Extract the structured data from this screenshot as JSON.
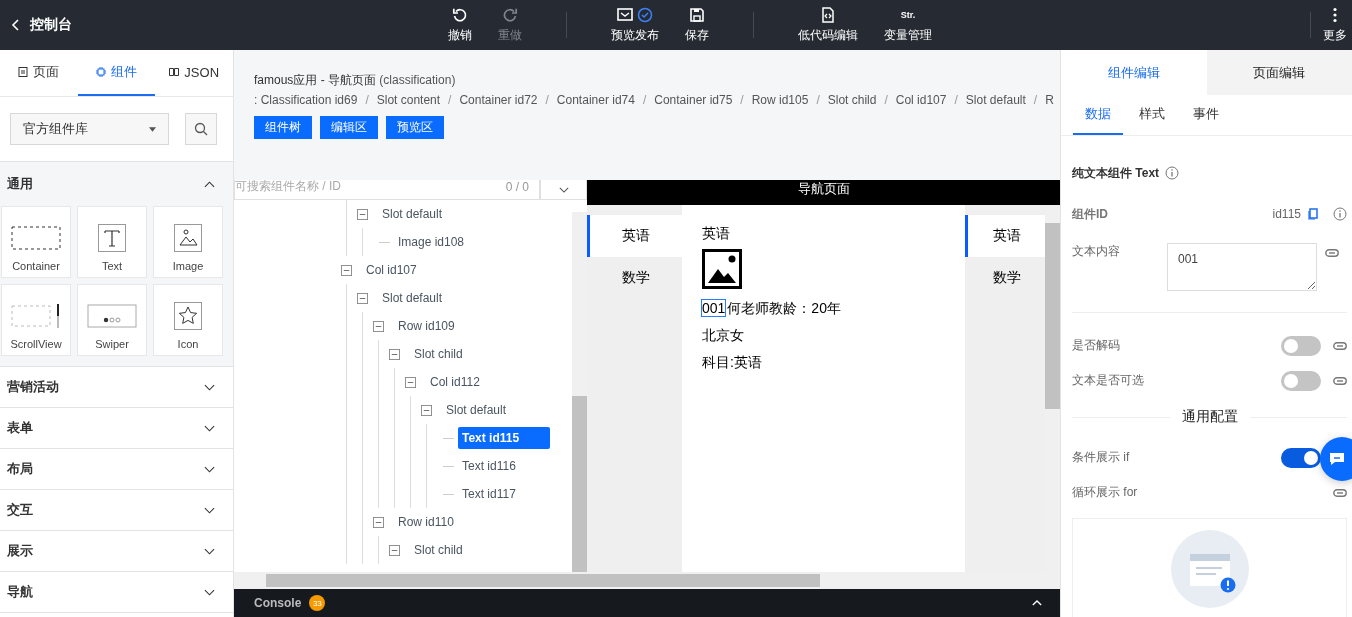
{
  "topbar": {
    "back_label": "控制台",
    "groups": [
      [
        {
          "kind": "undo",
          "label": "撤销",
          "disabled": false
        },
        {
          "kind": "redo",
          "label": "重做",
          "disabled": true
        }
      ],
      [
        {
          "kind": "preview",
          "label": "预览发布",
          "disabled": false
        },
        {
          "kind": "save",
          "label": "保存",
          "disabled": false
        }
      ],
      [
        {
          "kind": "code",
          "label": "低代码编辑",
          "disabled": false
        },
        {
          "kind": "variables",
          "label": "变量管理",
          "icon_text": "Str.",
          "disabled": false
        }
      ]
    ],
    "more": {
      "label": "更多"
    }
  },
  "left_panel": {
    "tabs": [
      {
        "kind": "page",
        "label": "页面",
        "selected": false
      },
      {
        "kind": "component",
        "label": "组件",
        "selected": true
      },
      {
        "kind": "json",
        "label": "JSON",
        "selected": false
      }
    ],
    "library_select": {
      "value": "官方组件库"
    },
    "categories": [
      {
        "title": "通用",
        "expanded": true,
        "components": [
          {
            "kind": "container",
            "label": "Container"
          },
          {
            "kind": "text",
            "label": "Text"
          },
          {
            "kind": "image",
            "label": "Image"
          },
          {
            "kind": "scrollview",
            "label": "ScrollView"
          },
          {
            "kind": "swiper",
            "label": "Swiper"
          },
          {
            "kind": "icon",
            "label": "Icon"
          }
        ]
      },
      {
        "title": "营销活动",
        "expanded": false
      },
      {
        "title": "表单",
        "expanded": false
      },
      {
        "title": "布局",
        "expanded": false
      },
      {
        "title": "交互",
        "expanded": false
      },
      {
        "title": "展示",
        "expanded": false
      },
      {
        "title": "导航",
        "expanded": false
      }
    ]
  },
  "editor_header": {
    "title": "famous应用 - 导航页面",
    "code": "(classification)",
    "breadcrumb": [
      ": Classification id69",
      "Slot content",
      "Container id72",
      "Container id74",
      "Container id75",
      "Row id105",
      "Slot child",
      "Col id107",
      "Slot default",
      "R"
    ],
    "separator": "/",
    "buttons": [
      "组件树",
      "编辑区",
      "预览区"
    ]
  },
  "component_tree": {
    "search": {
      "placeholder": "可搜索组件名称 / ID",
      "count": "0 / 0"
    },
    "nodes": [
      {
        "children": [
          {
            "label": "Slot default",
            "selected": false,
            "expanded": true,
            "children": [
              {
                "label": "Image id108",
                "selected": false
              }
            ]
          }
        ]
      },
      {
        "label": "Col id107",
        "selected": false,
        "expanded": true,
        "children": [
          {
            "label": "Slot default",
            "selected": false,
            "expanded": true,
            "children": [
              {
                "label": "Row id109",
                "selected": false,
                "expanded": true,
                "children": [
                  {
                    "label": "Slot child",
                    "selected": false,
                    "expanded": true,
                    "children": [
                      {
                        "label": "Col id112",
                        "selected": false,
                        "expanded": true,
                        "children": [
                          {
                            "label": "Slot default",
                            "selected": false,
                            "expanded": true,
                            "children": [
                              {
                                "label": "Text id115",
                                "selected": true
                              },
                              {
                                "label": "Text id116",
                                "selected": false
                              },
                              {
                                "label": "Text id117",
                                "selected": false
                              }
                            ]
                          }
                        ]
                      }
                    ]
                  }
                ]
              },
              {
                "label": "Row id110",
                "selected": false,
                "expanded": true,
                "children": [
                  {
                    "label": "Slot child",
                    "selected": false,
                    "expanded": true
                  }
                ]
              }
            ]
          }
        ]
      }
    ]
  },
  "preview": {
    "header_title": "导航页面",
    "nav": [
      {
        "label": "英语",
        "selected": true
      },
      {
        "label": "数学",
        "selected": false
      }
    ],
    "content": {
      "heading": "英语",
      "lines": [
        [
          {
            "text": "001",
            "selected": true
          },
          {
            "text": "何老师教龄：20年",
            "selected": false
          }
        ],
        [
          {
            "text": "北京女",
            "selected": false
          }
        ],
        [
          {
            "text": "科目:英语",
            "selected": false
          }
        ]
      ]
    },
    "side_nav": [
      {
        "label": "英语",
        "selected": true
      },
      {
        "label": "数学",
        "selected": false
      }
    ]
  },
  "console": {
    "label": "Console",
    "count": "33"
  },
  "right_panel": {
    "tabs": [
      {
        "label": "组件编辑",
        "selected": true
      },
      {
        "label": "页面编辑",
        "selected": false
      }
    ],
    "subtabs": [
      {
        "label": "数据",
        "selected": true
      },
      {
        "label": "样式",
        "selected": false
      },
      {
        "label": "事件",
        "selected": false
      }
    ],
    "component_title": "纯文本组件 Text",
    "id_label": "组件ID",
    "id_value": "id115",
    "text_content": {
      "label": "文本内容",
      "value": "001"
    },
    "switches": [
      {
        "label": "是否解码",
        "on": false
      },
      {
        "label": "文本是否可选",
        "on": false
      }
    ],
    "section_title": "通用配置",
    "condition": {
      "label": "条件展示 if",
      "on": true
    },
    "loop": {
      "label": "循环展示 for"
    }
  }
}
